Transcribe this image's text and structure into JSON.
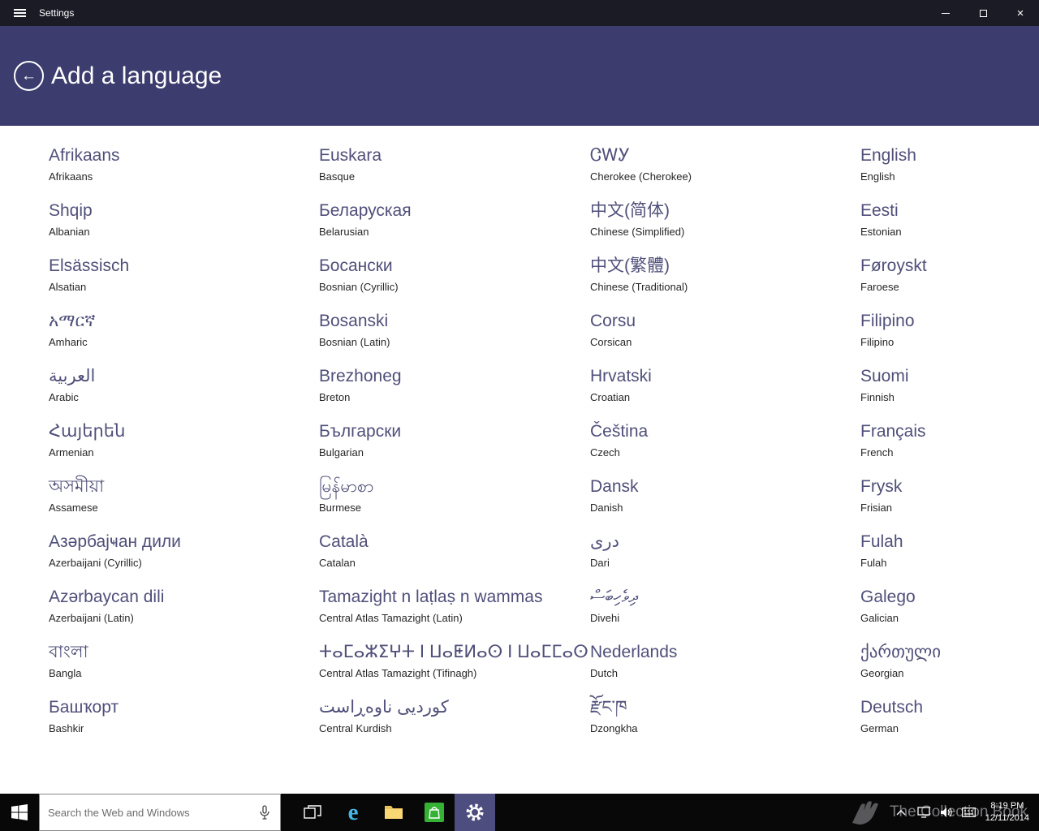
{
  "titlebar": {
    "title": "Settings"
  },
  "header": {
    "title": "Add a language"
  },
  "languages": [
    {
      "native": "Afrikaans",
      "english": "Afrikaans"
    },
    {
      "native": "Shqip",
      "english": "Albanian"
    },
    {
      "native": "Elsässisch",
      "english": "Alsatian"
    },
    {
      "native": "አማርኛ",
      "english": "Amharic"
    },
    {
      "native": "العربية",
      "english": "Arabic"
    },
    {
      "native": "Հայերեն",
      "english": "Armenian"
    },
    {
      "native": "অসমীয়া",
      "english": "Assamese"
    },
    {
      "native": "Азәрбајҹан дили",
      "english": "Azerbaijani (Cyrillic)"
    },
    {
      "native": "Azərbaycan dili",
      "english": "Azerbaijani (Latin)"
    },
    {
      "native": "বাংলা",
      "english": "Bangla"
    },
    {
      "native": "Башҡорт",
      "english": "Bashkir"
    },
    {
      "native": "Euskara",
      "english": "Basque"
    },
    {
      "native": "Беларуская",
      "english": "Belarusian"
    },
    {
      "native": "Босански",
      "english": "Bosnian (Cyrillic)"
    },
    {
      "native": "Bosanski",
      "english": "Bosnian (Latin)"
    },
    {
      "native": "Brezhoneg",
      "english": "Breton"
    },
    {
      "native": "Български",
      "english": "Bulgarian"
    },
    {
      "native": "မြန်မာစာ",
      "english": "Burmese"
    },
    {
      "native": "Català",
      "english": "Catalan"
    },
    {
      "native": "Tamazight n laṭlaṣ n wammas",
      "english": "Central Atlas Tamazight (Latin)"
    },
    {
      "native": "ⵜⴰⵎⴰⵣⵉⵖⵜ ⵏ ⵡⴰⵟⵍⴰⵙ ⵏ ⵡⴰⵎⵎⴰⵙ",
      "english": "Central Atlas Tamazight (Tifinagh)"
    },
    {
      "native": "کوردیی ناوەڕاست",
      "english": "Central Kurdish"
    },
    {
      "native": "ᏣᎳᎩ",
      "english": "Cherokee (Cherokee)"
    },
    {
      "native": "中文(简体)",
      "english": "Chinese (Simplified)"
    },
    {
      "native": "中文(繁體)",
      "english": "Chinese (Traditional)"
    },
    {
      "native": "Corsu",
      "english": "Corsican"
    },
    {
      "native": "Hrvatski",
      "english": "Croatian"
    },
    {
      "native": "Čeština",
      "english": "Czech"
    },
    {
      "native": "Dansk",
      "english": "Danish"
    },
    {
      "native": "درى",
      "english": "Dari"
    },
    {
      "native": "ދިވެހިބަސް",
      "english": "Divehi"
    },
    {
      "native": "Nederlands",
      "english": "Dutch"
    },
    {
      "native": "རྫོང་ཁ",
      "english": "Dzongkha"
    },
    {
      "native": "English",
      "english": "English"
    },
    {
      "native": "Eesti",
      "english": "Estonian"
    },
    {
      "native": "Føroyskt",
      "english": "Faroese"
    },
    {
      "native": "Filipino",
      "english": "Filipino"
    },
    {
      "native": "Suomi",
      "english": "Finnish"
    },
    {
      "native": "Français",
      "english": "French"
    },
    {
      "native": "Frysk",
      "english": "Frisian"
    },
    {
      "native": "Fulah",
      "english": "Fulah"
    },
    {
      "native": "Galego",
      "english": "Galician"
    },
    {
      "native": "ქართული",
      "english": "Georgian"
    },
    {
      "native": "Deutsch",
      "english": "German"
    }
  ],
  "taskbar": {
    "search_placeholder": "Search the Web and Windows",
    "clock_time": "8:19 PM",
    "clock_date": "12/11/2014"
  },
  "watermark": {
    "text": "The Collection Book"
  },
  "icons": {
    "hamburger": "css-three-lines",
    "back_arrow": "←",
    "minimize": "css-line",
    "maximize": "css-square",
    "close": "×",
    "start": "svg-windows-logo",
    "search_mic": "svg-microphone",
    "task_view": "svg-overlapping-windows",
    "browser": "e",
    "file_explorer": "svg-folder",
    "store": "svg-shopping-bag",
    "settings_gear": "svg-gear",
    "tray_chevron": "svg-chevron-up",
    "tray_network": "svg-monitor",
    "tray_volume": "svg-speaker",
    "tray_keyboard": "svg-keyboard"
  },
  "colors": {
    "titlebar_bg": "#1B1B26",
    "header_bg": "#3C3C6E",
    "language_name": "#4F4F7A",
    "language_sub": "#262626",
    "taskbar_bg": "#080808",
    "active_app_bg": "#4D4D80",
    "store_green": "#35B234",
    "browser_blue": "#45B6E8",
    "folder_yellow": "#F8D775"
  }
}
